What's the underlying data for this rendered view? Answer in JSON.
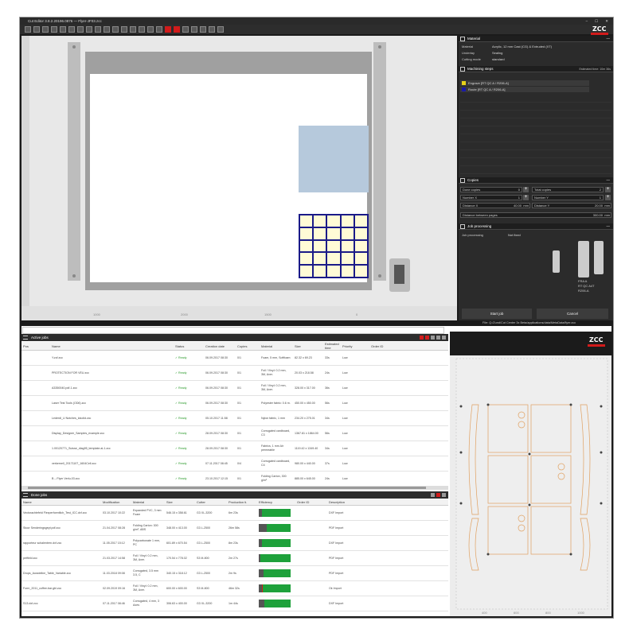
{
  "app": {
    "title": "Cut Editor 3.8.2.20196.0876 — Flyer-JF03.zcc",
    "window_controls": [
      "–",
      "☐",
      "✕"
    ],
    "brand": "ZCC"
  },
  "ruler": {
    "labels": [
      "1000",
      "2000",
      "1500",
      "0"
    ]
  },
  "material": {
    "header": "Material",
    "rows": [
      {
        "key": "Material",
        "value": "Acrylic, 12 mm Cast (CG) & Extruded (XT)"
      },
      {
        "key": "Underlay",
        "value": "Sealing"
      },
      {
        "key": "Cutting mode",
        "value": "standard"
      }
    ]
  },
  "machining": {
    "header": "Machining steps",
    "estimated_time": "Estimated time: 10m 36s",
    "steps": [
      {
        "label": "Engrave [RT QC A / R206-A]",
        "color": "#e8d21a"
      },
      {
        "label": "Route [RT QC A / R206-A]",
        "color": "#1a1aa8"
      }
    ]
  },
  "copies": {
    "header": "Copies",
    "fields": [
      {
        "label": "Done copies",
        "value": "0"
      },
      {
        "label": "Total copies",
        "value": "2"
      },
      {
        "label": "Number X",
        "value": "1"
      },
      {
        "label": "Number Y",
        "value": "1"
      },
      {
        "label": "Distance X",
        "value": "40.00",
        "unit": "mm"
      },
      {
        "label": "Distance Y",
        "value": "20.00",
        "unit": "mm"
      }
    ],
    "between_label": "Distance between pages",
    "between_value": "300.00",
    "between_unit": "mm"
  },
  "job_processing": {
    "header": "Job processing",
    "row_key": "Job processing",
    "row_value": "Not fixed",
    "tool_labels": [
      "FRA A",
      "RT QC A4T",
      "R206-A"
    ]
  },
  "buttons": {
    "start": "Start job",
    "cancel": "Cancel"
  },
  "statusbar": "File: Q:/Zund/Cut Center 3x Beta/applications/data/MetaData/flyer.zcc",
  "active_jobs": {
    "title": "Active jobs",
    "columns": [
      "Pos",
      "Name",
      "Status",
      "Creation date",
      "Copies",
      "Material",
      "Size",
      "Estimated time",
      "Priority",
      "Order ID"
    ],
    "rows": [
      [
        "",
        "Y.zcf.zcc",
        "Ready",
        "06.09.2017 08:30",
        "0/1",
        "Foam, 5 mm, Softfoam",
        "82.32 x 69.23",
        "33s",
        "Low",
        ""
      ],
      [
        "",
        "PROTECTION FOR VEU.zcc",
        "Ready",
        "06.09.2017 08:30",
        "0/1",
        "Foil / Vinyl: 0.2 mm, 3M, Aver.",
        "20.03 x 218.58",
        "24s",
        "Low",
        ""
      ],
      [
        "",
        "A3350040.pdf-1.zcc",
        "Ready",
        "06.09.2017 08:30",
        "0/1",
        "Foil / Vinyl: 0.2 mm, 3M, Aver.",
        "328.00 x 317.00",
        "36s",
        "Low",
        ""
      ],
      [
        "",
        "Laser Test Tools (OD6).zcc",
        "Ready",
        "06.09.2017 08:30",
        "0/1",
        "Polyester fabric: 0.6 m.",
        "450.00 x 450.00",
        "56s",
        "Low",
        ""
      ],
      [
        "",
        "Lederdl_U Notches_lokolid.zcc",
        "Ready",
        "05.10.2017 11:58",
        "0/1",
        "Nylon fabric, 1 mm",
        "234.20 x 275.01",
        "34s",
        "Low",
        ""
      ],
      [
        "",
        "Display_Designer_Samples_example.zcc",
        "Ready",
        "28.09.2017 08:30",
        "0/1",
        "Corrugated cardboard, C3",
        "1367.81 x 1864.00",
        "56s",
        "Low",
        ""
      ],
      [
        "",
        "1.00120771_Suisse_diag95_template.ai-1.zcc",
        "Ready",
        "28.09.2017 08:30",
        "0/1",
        "Fabrics, 1 mm Air permeable",
        "1119.42 x 1349.40",
        "34s",
        "Low",
        ""
      ],
      [
        "",
        "verkernell_20171107_1604Cell.zcc",
        "Ready",
        "07.11.2017 08:45",
        "0/4",
        "Corrugated cardboard, C4",
        "980.00 x 440.00",
        "37s",
        "Low",
        ""
      ],
      [
        "",
        "B – Flyer Verlu-03.zcc",
        "Ready",
        "23.10.2017 12:15",
        "0/1",
        "Folding Carton, 300 g/m²",
        "885.00 x 645.00",
        "24s",
        "Low",
        ""
      ]
    ]
  },
  "done_jobs": {
    "title": "Done jobs",
    "columns": [
      "Name",
      "Modification",
      "Material",
      "Size",
      "Cutter",
      "Production ti.",
      "Efficiency",
      "Order ID",
      "Description"
    ],
    "rows": [
      {
        "name": "Vectorachtefeld Flexperfoentlich_Test_ICC.dxf.zcc",
        "mod": "03.10.2017 10:22",
        "material": "Expanded PVC, 3 mm Foam",
        "size": "546.15 x 358.61",
        "cutter": "G3 XL-3200",
        "prod": "6m 23s",
        "gray": 10,
        "red": 0,
        "order": "",
        "desc": "DXF Import"
      },
      {
        "name": "Stoor Senderingsgeyt.pdf.zcc",
        "mod": "21.04.2017 08:28",
        "material": "Folding Carton: 300 g/m², ABS",
        "size": "348.00 x 413.00",
        "cutter": "G3 L-2500",
        "prod": "26m 58s",
        "gray": 25,
        "red": 0,
        "order": "",
        "desc": "PDF Import"
      },
      {
        "name": "rapporteur schalentern.dxf.zcc",
        "mod": "11.05.2017 15:12",
        "material": "Polycarbonate 1 mm, PC",
        "size": "601.89 x 670.54",
        "cutter": "G3 L-2500",
        "prod": "8m 23s",
        "gray": 10,
        "red": 0,
        "order": "",
        "desc": "DXF Import"
      },
      {
        "name": "petfield.zcc",
        "mod": "21.03.2017 14:58",
        "material": "Foil / Vinyl: 0.2 mm, 3M, Aver.",
        "size": "170.54 x 778.02",
        "cutter": "S3 M-800",
        "prod": "2m 27s",
        "gray": 5,
        "red": 0,
        "order": "",
        "desc": "PDF Import"
      },
      {
        "name": "Drops_Ausstellne_Table_Variable.zcc",
        "mod": "11.03.2018 09:08",
        "material": "Corrugated, 3.5 mm 3.5, C",
        "size": "340.15 x 318.12",
        "cutter": "G3 L-2500",
        "prod": "2m 9s",
        "gray": 15,
        "red": 0,
        "order": "",
        "desc": "PDF Import"
      },
      {
        "name": "Form_2011_coffee-bar.gbl.zcc",
        "mod": "02.09.2019 09:16",
        "material": "Foil / Vinyl: 0.2 mm, 3M, Aver.",
        "size": "600.00 x 600.00",
        "cutter": "S3 M-800",
        "prod": "46m 32s",
        "gray": 10,
        "red": 3,
        "order": "",
        "desc": "Ok Import"
      },
      {
        "name": "S13.dxf.zcc",
        "mod": "07.11.2017 08:46",
        "material": "Corrugated, 4 mm, 3 Axes",
        "size": "306.63 x 400.00",
        "cutter": "G3 XL-3200",
        "prod": "1m 44s",
        "gray": 18,
        "red": 0,
        "order": "",
        "desc": "DXF Import"
      }
    ]
  },
  "preview": {
    "axis_labels": [
      "400",
      "600",
      "800",
      "1000"
    ]
  }
}
